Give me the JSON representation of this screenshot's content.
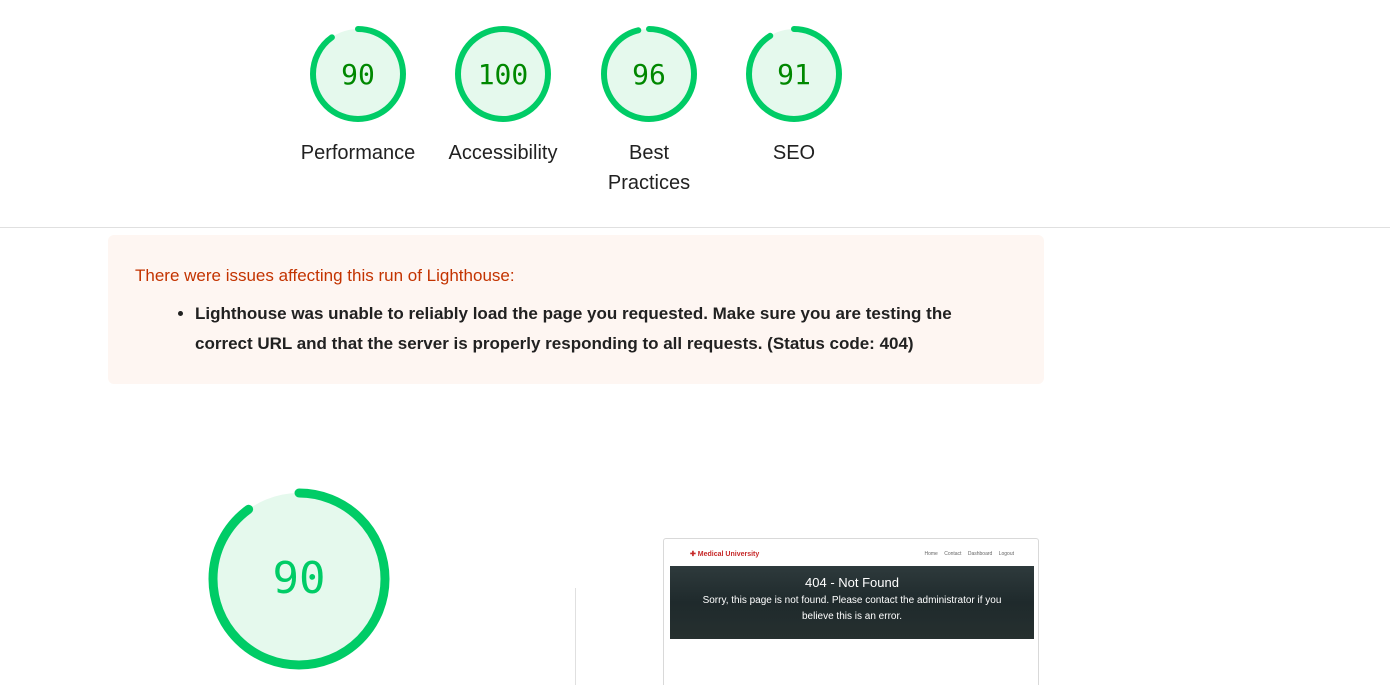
{
  "scores": [
    {
      "value": 90,
      "label": "Performance"
    },
    {
      "value": 100,
      "label": "Accessibility"
    },
    {
      "value": 96,
      "label": "Best Practices"
    },
    {
      "value": 91,
      "label": "SEO"
    }
  ],
  "colors": {
    "pass_ring": "#00cc66",
    "pass_fill": "#e5f9ed",
    "pass_text": "#008800",
    "warning_title": "#c33300",
    "warning_bg": "#fef6f2"
  },
  "warning": {
    "title": "There were issues affecting this run of Lighthouse:",
    "items": [
      "Lighthouse was unable to reliably load the page you requested. Make sure you are testing the correct URL and that the server is properly responding to all requests. (Status code: 404)"
    ]
  },
  "main_score": {
    "value": 90
  },
  "screenshot": {
    "brand": "✚ Medical University",
    "nav_links": [
      "Home",
      "Contact",
      "Dashboard",
      "Logout"
    ],
    "heading": "404 - Not Found",
    "message": "Sorry, this page is not found. Please contact the administrator if you believe this is an error."
  }
}
